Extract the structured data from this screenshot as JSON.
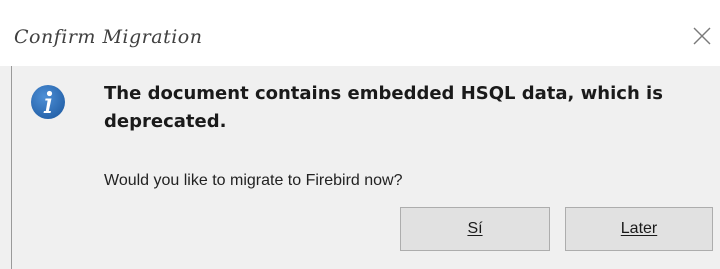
{
  "dialog": {
    "title": "Confirm Migration",
    "main_instruction": "The document contains embedded HSQL data, which is deprecated.",
    "secondary_text": "Would you like to migrate to Firebird now?",
    "icons": {
      "info": "info-icon",
      "close": "close-icon"
    },
    "buttons": {
      "yes_label": "Sí",
      "later_label": "Later"
    },
    "colors": {
      "info_icon": "#2f6fb3",
      "content_bg": "#f0f0f0",
      "titlebar_bg": "#ffffff",
      "button_bg": "#e1e1e1"
    }
  }
}
